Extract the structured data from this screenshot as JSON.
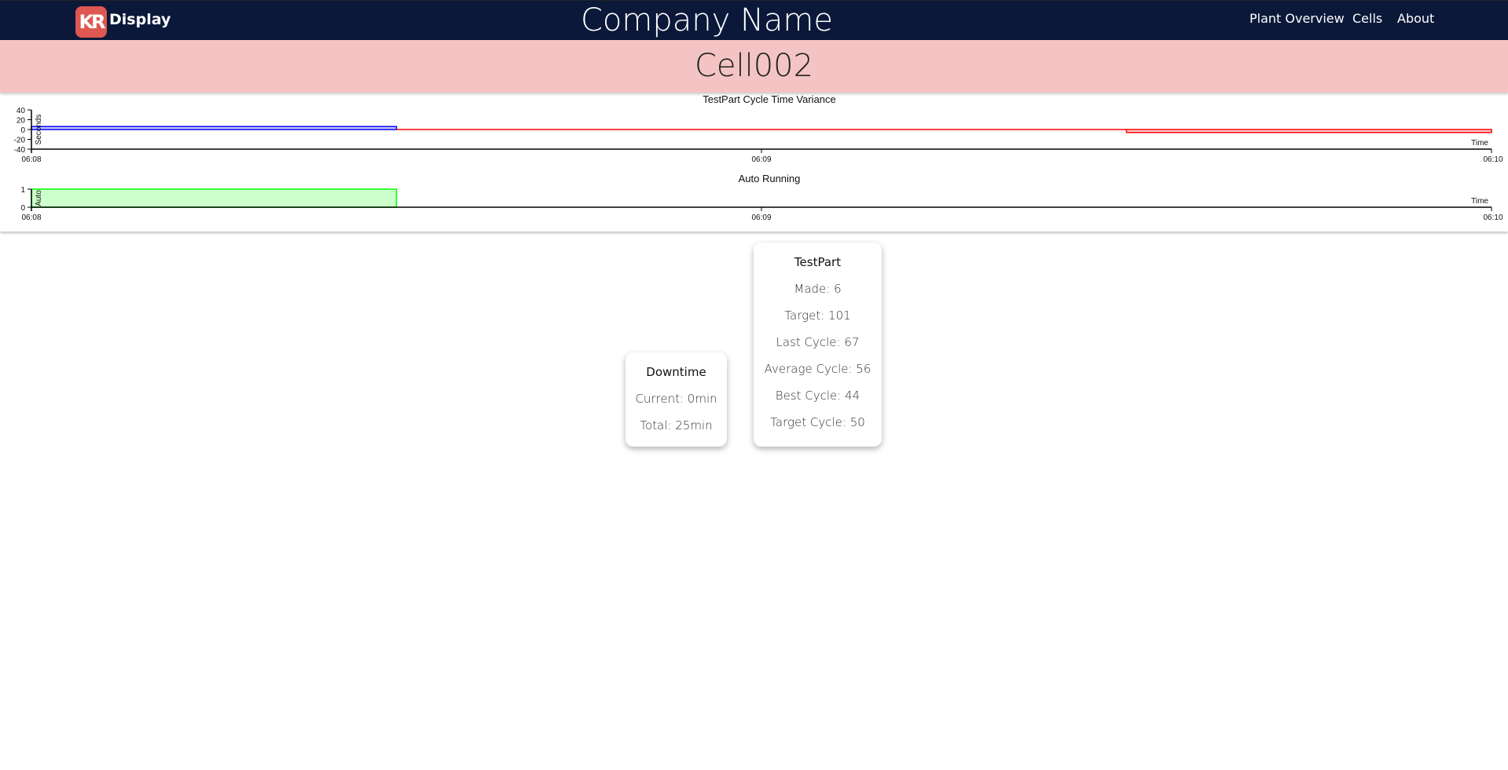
{
  "nav": {
    "logo_text": "KR",
    "brand": "Display",
    "company": "Company Name",
    "links": [
      "Plant Overview",
      "Cells",
      "About"
    ]
  },
  "page_title": "Cell002",
  "chart_data": [
    {
      "type": "area",
      "title": "TestPart Cycle Time Variance",
      "ylabel": "Seconds",
      "xlabel": "Time",
      "x_ticks": [
        "06:08",
        "06:09",
        "06:10"
      ],
      "y_ticks": [
        40,
        20,
        0,
        -20,
        -40
      ],
      "ylim": [
        -40,
        40
      ],
      "xlim": [
        "06:08:00",
        "06:10:00"
      ],
      "series": [
        {
          "segments": [
            {
              "start": "06:08:00",
              "end": "06:08:30",
              "value": 6
            }
          ],
          "color": "#0000ff"
        },
        {
          "segments": [
            {
              "start": "06:08:30",
              "end": "06:09:30",
              "value": 0
            },
            {
              "start": "06:09:30",
              "end": "06:10:00",
              "value": -6
            }
          ],
          "color": "#ff0000"
        }
      ]
    },
    {
      "type": "area",
      "title": "Auto Running",
      "ylabel": "Auto",
      "xlabel": "Time",
      "x_ticks": [
        "06:08",
        "06:09",
        "06:10"
      ],
      "y_ticks": [
        1,
        0
      ],
      "ylim": [
        0,
        1
      ],
      "xlim": [
        "06:08:00",
        "06:10:00"
      ],
      "series": [
        {
          "segments": [
            {
              "start": "06:08:00",
              "end": "06:08:30",
              "value": 1
            }
          ],
          "color": "#00ff00"
        }
      ]
    }
  ],
  "downtime": {
    "title": "Downtime",
    "rows": [
      "Current: 0min",
      "Total: 25min"
    ]
  },
  "part": {
    "title": "TestPart",
    "rows": [
      "Made: 6",
      "Target: 101",
      "Last Cycle: 67",
      "Average Cycle: 56",
      "Best Cycle: 44",
      "Target Cycle: 50"
    ]
  }
}
